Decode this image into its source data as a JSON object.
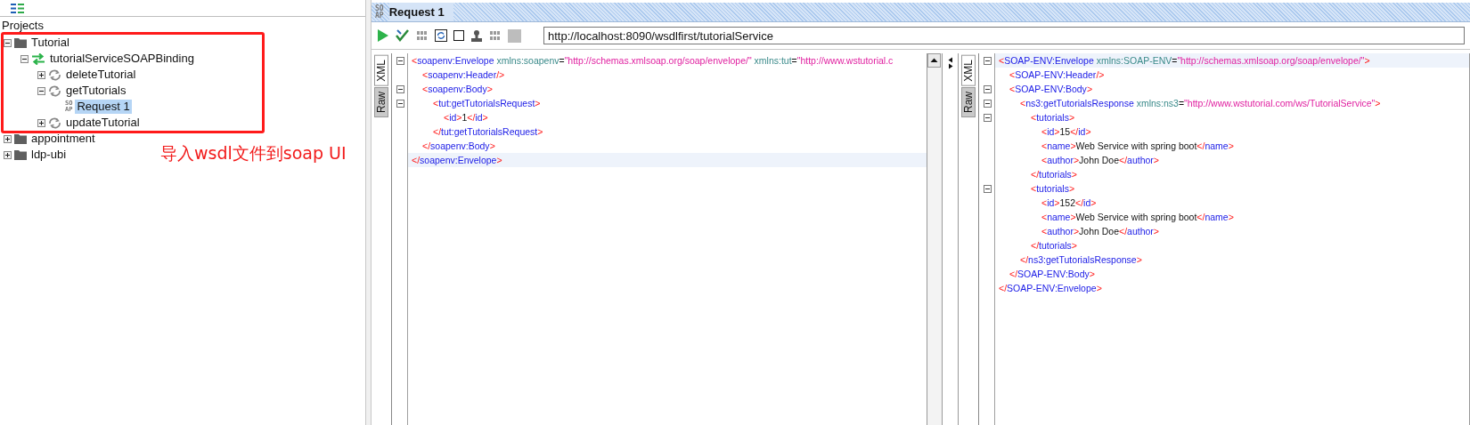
{
  "navigator": {
    "title": "Projects",
    "items": [
      {
        "kind": "project",
        "label": "Tutorial",
        "expanded": true,
        "selected": false,
        "annotated": true,
        "children": [
          {
            "kind": "interface",
            "label": "tutorialServiceSOAPBinding",
            "expanded": true,
            "selected": false,
            "children": [
              {
                "kind": "operation",
                "label": "deleteTutorial",
                "expanded": false,
                "selected": false
              },
              {
                "kind": "operation",
                "label": "getTutorials",
                "expanded": true,
                "selected": false,
                "children": [
                  {
                    "kind": "request",
                    "label": "Request 1",
                    "badge": "SOAP",
                    "selected": true
                  }
                ]
              },
              {
                "kind": "operation",
                "label": "updateTutorial",
                "expanded": false,
                "selected": false
              }
            ]
          }
        ]
      },
      {
        "kind": "project",
        "label": "appointment",
        "expanded": false,
        "selected": false,
        "annotated": false
      },
      {
        "kind": "project",
        "label": "ldp-ubi",
        "expanded": false,
        "selected": false,
        "annotated": false
      }
    ],
    "annotation": "导入wsdl文件到soap UI"
  },
  "request": {
    "badge": "SOAP",
    "title": "Request 1",
    "endpoint": "http://localhost:8090/wsdlfirst/tutorialService"
  },
  "editors": [
    {
      "tabs": [
        {
          "label": "XML",
          "selected": true
        },
        {
          "label": "Raw",
          "selected": false
        }
      ],
      "lines": [
        {
          "fold": true,
          "current": false,
          "tokens": [
            {
              "kind": "p",
              "text": "<"
            },
            {
              "kind": "tag",
              "text": "soapenv:Envelope"
            },
            {
              "kind": "attr",
              "text": " xmlns:soapenv"
            },
            {
              "kind": "eq",
              "text": "="
            },
            {
              "kind": "val",
              "text": "\"http://schemas.xmlsoap.org/soap/envelope/\""
            },
            {
              "kind": "attr",
              "text": " xmlns:tut"
            },
            {
              "kind": "eq",
              "text": "="
            },
            {
              "kind": "val",
              "text": "\"http://www.wstutorial.c"
            }
          ],
          "children": [
            {
              "fold": false,
              "current": false,
              "tokens": [
                {
                  "kind": "p",
                  "text": "<"
                },
                {
                  "kind": "tag",
                  "text": "soapenv:Header"
                },
                {
                  "kind": "p",
                  "text": "/>"
                }
              ]
            },
            {
              "fold": true,
              "current": false,
              "tokens": [
                {
                  "kind": "p",
                  "text": "<"
                },
                {
                  "kind": "tag",
                  "text": "soapenv:Body"
                },
                {
                  "kind": "p",
                  "text": ">"
                }
              ],
              "children": [
                {
                  "fold": true,
                  "current": false,
                  "tokens": [
                    {
                      "kind": "p",
                      "text": "<"
                    },
                    {
                      "kind": "tag",
                      "text": "tut:getTutorialsRequest"
                    },
                    {
                      "kind": "p",
                      "text": ">"
                    }
                  ],
                  "children": [
                    {
                      "fold": false,
                      "current": false,
                      "tokens": [
                        {
                          "kind": "p",
                          "text": "<"
                        },
                        {
                          "kind": "tag",
                          "text": "id"
                        },
                        {
                          "kind": "p",
                          "text": ">"
                        },
                        {
                          "kind": "txt",
                          "text": "1"
                        },
                        {
                          "kind": "p",
                          "text": "</"
                        },
                        {
                          "kind": "tag",
                          "text": "id"
                        },
                        {
                          "kind": "p",
                          "text": ">"
                        }
                      ]
                    }
                  ]
                },
                {
                  "fold": false,
                  "current": false,
                  "tokens": [
                    {
                      "kind": "p",
                      "text": "</"
                    },
                    {
                      "kind": "tag",
                      "text": "tut:getTutorialsRequest"
                    },
                    {
                      "kind": "p",
                      "text": ">"
                    }
                  ]
                }
              ]
            },
            {
              "fold": false,
              "current": false,
              "tokens": [
                {
                  "kind": "p",
                  "text": "</"
                },
                {
                  "kind": "tag",
                  "text": "soapenv:Body"
                },
                {
                  "kind": "p",
                  "text": ">"
                }
              ]
            }
          ]
        },
        {
          "fold": false,
          "current": true,
          "tokens": [
            {
              "kind": "p",
              "text": "</"
            },
            {
              "kind": "tag",
              "text": "soapenv:Envelope"
            },
            {
              "kind": "p",
              "text": ">"
            }
          ]
        }
      ]
    },
    {
      "tabs": [
        {
          "label": "XML",
          "selected": true
        },
        {
          "label": "Raw",
          "selected": false
        }
      ],
      "lines": [
        {
          "fold": true,
          "current": true,
          "tokens": [
            {
              "kind": "p",
              "text": "<"
            },
            {
              "kind": "tag",
              "text": "SOAP-ENV:Envelope"
            },
            {
              "kind": "attr",
              "text": " xmlns:SOAP-ENV"
            },
            {
              "kind": "eq",
              "text": "="
            },
            {
              "kind": "val",
              "text": "\"http://schemas.xmlsoap.org/soap/envelope/\""
            },
            {
              "kind": "p",
              "text": ">"
            }
          ],
          "children": [
            {
              "fold": false,
              "current": false,
              "tokens": [
                {
                  "kind": "p",
                  "text": "<"
                },
                {
                  "kind": "tag",
                  "text": "SOAP-ENV:Header"
                },
                {
                  "kind": "p",
                  "text": "/>"
                }
              ]
            },
            {
              "fold": true,
              "current": false,
              "tokens": [
                {
                  "kind": "p",
                  "text": "<"
                },
                {
                  "kind": "tag",
                  "text": "SOAP-ENV:Body"
                },
                {
                  "kind": "p",
                  "text": ">"
                }
              ],
              "children": [
                {
                  "fold": true,
                  "current": false,
                  "tokens": [
                    {
                      "kind": "p",
                      "text": "<"
                    },
                    {
                      "kind": "tag",
                      "text": "ns3:getTutorialsResponse"
                    },
                    {
                      "kind": "attr",
                      "text": " xmlns:ns3"
                    },
                    {
                      "kind": "eq",
                      "text": "="
                    },
                    {
                      "kind": "val",
                      "text": "\"http://www.wstutorial.com/ws/TutorialService\""
                    },
                    {
                      "kind": "p",
                      "text": ">"
                    }
                  ],
                  "children": [
                    {
                      "fold": true,
                      "current": false,
                      "tokens": [
                        {
                          "kind": "p",
                          "text": "<"
                        },
                        {
                          "kind": "tag",
                          "text": "tutorials"
                        },
                        {
                          "kind": "p",
                          "text": ">"
                        }
                      ],
                      "children": [
                        {
                          "fold": false,
                          "current": false,
                          "tokens": [
                            {
                              "kind": "p",
                              "text": "<"
                            },
                            {
                              "kind": "tag",
                              "text": "id"
                            },
                            {
                              "kind": "p",
                              "text": ">"
                            },
                            {
                              "kind": "txt",
                              "text": "15"
                            },
                            {
                              "kind": "p",
                              "text": "</"
                            },
                            {
                              "kind": "tag",
                              "text": "id"
                            },
                            {
                              "kind": "p",
                              "text": ">"
                            }
                          ]
                        },
                        {
                          "fold": false,
                          "current": false,
                          "tokens": [
                            {
                              "kind": "p",
                              "text": "<"
                            },
                            {
                              "kind": "tag",
                              "text": "name"
                            },
                            {
                              "kind": "p",
                              "text": ">"
                            },
                            {
                              "kind": "txt",
                              "text": "Web Service with spring boot"
                            },
                            {
                              "kind": "p",
                              "text": "</"
                            },
                            {
                              "kind": "tag",
                              "text": "name"
                            },
                            {
                              "kind": "p",
                              "text": ">"
                            }
                          ]
                        },
                        {
                          "fold": false,
                          "current": false,
                          "tokens": [
                            {
                              "kind": "p",
                              "text": "<"
                            },
                            {
                              "kind": "tag",
                              "text": "author"
                            },
                            {
                              "kind": "p",
                              "text": ">"
                            },
                            {
                              "kind": "txt",
                              "text": "John Doe"
                            },
                            {
                              "kind": "p",
                              "text": "</"
                            },
                            {
                              "kind": "tag",
                              "text": "author"
                            },
                            {
                              "kind": "p",
                              "text": ">"
                            }
                          ]
                        }
                      ]
                    },
                    {
                      "fold": false,
                      "current": false,
                      "tokens": [
                        {
                          "kind": "p",
                          "text": "</"
                        },
                        {
                          "kind": "tag",
                          "text": "tutorials"
                        },
                        {
                          "kind": "p",
                          "text": ">"
                        }
                      ]
                    },
                    {
                      "fold": true,
                      "current": false,
                      "tokens": [
                        {
                          "kind": "p",
                          "text": "<"
                        },
                        {
                          "kind": "tag",
                          "text": "tutorials"
                        },
                        {
                          "kind": "p",
                          "text": ">"
                        }
                      ],
                      "children": [
                        {
                          "fold": false,
                          "current": false,
                          "tokens": [
                            {
                              "kind": "p",
                              "text": "<"
                            },
                            {
                              "kind": "tag",
                              "text": "id"
                            },
                            {
                              "kind": "p",
                              "text": ">"
                            },
                            {
                              "kind": "txt",
                              "text": "152"
                            },
                            {
                              "kind": "p",
                              "text": "</"
                            },
                            {
                              "kind": "tag",
                              "text": "id"
                            },
                            {
                              "kind": "p",
                              "text": ">"
                            }
                          ]
                        },
                        {
                          "fold": false,
                          "current": false,
                          "tokens": [
                            {
                              "kind": "p",
                              "text": "<"
                            },
                            {
                              "kind": "tag",
                              "text": "name"
                            },
                            {
                              "kind": "p",
                              "text": ">"
                            },
                            {
                              "kind": "txt",
                              "text": "Web Service with spring boot"
                            },
                            {
                              "kind": "p",
                              "text": "</"
                            },
                            {
                              "kind": "tag",
                              "text": "name"
                            },
                            {
                              "kind": "p",
                              "text": ">"
                            }
                          ]
                        },
                        {
                          "fold": false,
                          "current": false,
                          "tokens": [
                            {
                              "kind": "p",
                              "text": "<"
                            },
                            {
                              "kind": "tag",
                              "text": "author"
                            },
                            {
                              "kind": "p",
                              "text": ">"
                            },
                            {
                              "kind": "txt",
                              "text": "John Doe"
                            },
                            {
                              "kind": "p",
                              "text": "</"
                            },
                            {
                              "kind": "tag",
                              "text": "author"
                            },
                            {
                              "kind": "p",
                              "text": ">"
                            }
                          ]
                        }
                      ]
                    },
                    {
                      "fold": false,
                      "current": false,
                      "tokens": [
                        {
                          "kind": "p",
                          "text": "</"
                        },
                        {
                          "kind": "tag",
                          "text": "tutorials"
                        },
                        {
                          "kind": "p",
                          "text": ">"
                        }
                      ]
                    }
                  ]
                },
                {
                  "fold": false,
                  "current": false,
                  "tokens": [
                    {
                      "kind": "p",
                      "text": "</"
                    },
                    {
                      "kind": "tag",
                      "text": "ns3:getTutorialsResponse"
                    },
                    {
                      "kind": "p",
                      "text": ">"
                    }
                  ]
                }
              ]
            },
            {
              "fold": false,
              "current": false,
              "tokens": [
                {
                  "kind": "p",
                  "text": "</"
                },
                {
                  "kind": "tag",
                  "text": "SOAP-ENV:Body"
                },
                {
                  "kind": "p",
                  "text": ">"
                }
              ]
            }
          ]
        },
        {
          "fold": false,
          "current": false,
          "tokens": [
            {
              "kind": "p",
              "text": "</"
            },
            {
              "kind": "tag",
              "text": "SOAP-ENV:Envelope"
            },
            {
              "kind": "p",
              "text": ">"
            }
          ]
        }
      ]
    }
  ]
}
